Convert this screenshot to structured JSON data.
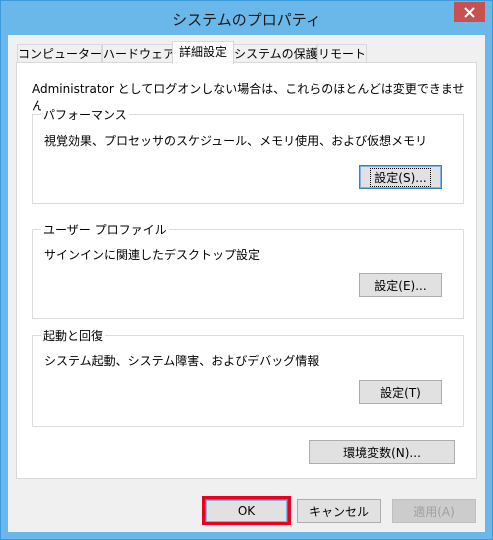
{
  "window": {
    "title": "システムのプロパティ"
  },
  "tabs": [
    {
      "label": "コンピューター名",
      "active": false
    },
    {
      "label": "ハードウェア",
      "active": false
    },
    {
      "label": "詳細設定",
      "active": true
    },
    {
      "label": "システムの保護",
      "active": false
    },
    {
      "label": "リモート",
      "active": false
    }
  ],
  "intro_text": "Administrator としてログオンしない場合は、これらのほとんどは変更できません。",
  "groups": {
    "performance": {
      "title": "パフォーマンス",
      "desc": "視覚効果、プロセッサのスケジュール、メモリ使用、および仮想メモリ",
      "button": "設定(S)..."
    },
    "profile": {
      "title": "ユーザー プロファイル",
      "desc": "サインインに関連したデスクトップ設定",
      "button": "設定(E)..."
    },
    "startup": {
      "title": "起動と回復",
      "desc": "システム起動、システム障害、およびデバッグ情報",
      "button": "設定(T)"
    }
  },
  "env_button": "環境変数(N)...",
  "footer": {
    "ok": "OK",
    "cancel": "キャンセル",
    "apply": "適用(A)"
  },
  "colors": {
    "titlebar": "#6ab8e9",
    "close": "#c75050",
    "highlight": "#e8001c"
  }
}
